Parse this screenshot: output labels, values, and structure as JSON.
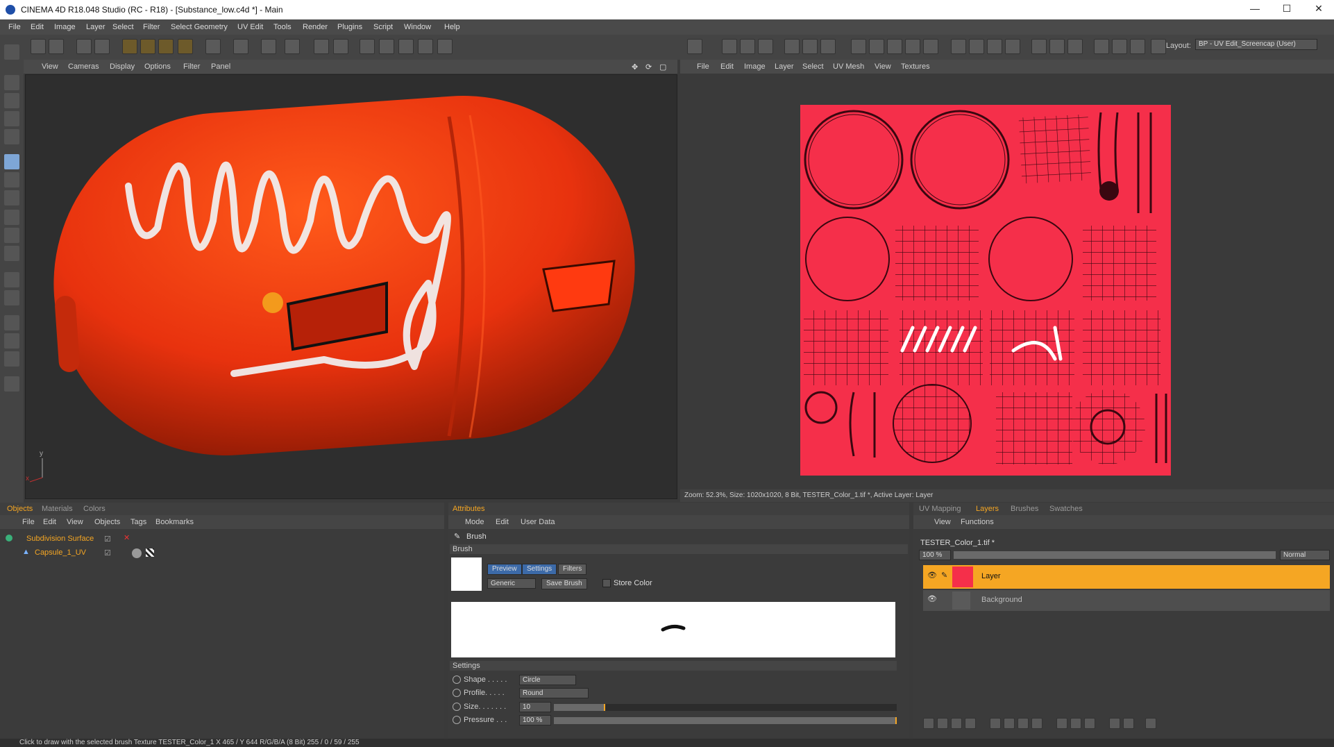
{
  "window": {
    "title": "CINEMA 4D R18.048 Studio (RC - R18) - [Substance_low.c4d *] - Main",
    "controls": [
      "—",
      "☐",
      "✕"
    ]
  },
  "menubar": [
    "File",
    "Edit",
    "Image",
    "Layer",
    "Select",
    "Filter",
    "Select Geometry",
    "UV Edit",
    "Tools",
    "Render",
    "Plugins",
    "Script",
    "Window",
    "Help"
  ],
  "layout": {
    "label": "Layout:",
    "value": "BP - UV Edit_Screencap (User)"
  },
  "viewport": {
    "menu": [
      "View",
      "Cameras",
      "Display",
      "Options",
      "Filter",
      "Panel"
    ],
    "axis_labels": {
      "x": "x",
      "y": "y"
    }
  },
  "uv_editor": {
    "menu": [
      "File",
      "Edit",
      "Image",
      "Layer",
      "Select",
      "UV Mesh",
      "View",
      "Textures"
    ],
    "status": "Zoom: 52.3%, Size: 1020x1020, 8 Bit, TESTER_Color_1.tif *, Active Layer: Layer"
  },
  "objects_panel": {
    "tabs": [
      "Objects",
      "Materials",
      "Colors"
    ],
    "menu": [
      "File",
      "Edit",
      "View",
      "Objects",
      "Tags",
      "Bookmarks"
    ],
    "items": [
      {
        "name": "Subdivision Surface"
      },
      {
        "name": "Capsule_1_UV"
      }
    ]
  },
  "attributes_panel": {
    "tabs": [
      "Attributes"
    ],
    "menu": [
      "Mode",
      "Edit",
      "User Data"
    ],
    "tool_name": "Brush",
    "section": "Brush",
    "subtabs": [
      "Preview",
      "Settings",
      "Filters"
    ],
    "preset": "Generic",
    "save_brush": "Save Brush",
    "store_color": "Store Color",
    "settings_header": "Settings",
    "settings": [
      {
        "label": "Shape . . . . .",
        "value": "Circle"
      },
      {
        "label": "Profile. . . . .",
        "value": "Round"
      },
      {
        "label": "Size. . . . . . .",
        "value": "10",
        "fill_fraction": 0.15
      },
      {
        "label": "Pressure . . .",
        "value": "100 %",
        "fill_fraction": 1.0
      }
    ]
  },
  "layers_panel": {
    "tabs": [
      "UV Mapping",
      "Layers",
      "Brushes",
      "Swatches"
    ],
    "menu": [
      "View",
      "Functions"
    ],
    "file": "TESTER_Color_1.tif *",
    "opacity": "100 %",
    "blend_mode": "Normal",
    "layers": [
      {
        "name": "Layer",
        "active": true
      },
      {
        "name": "Background",
        "active": false
      }
    ]
  },
  "statusbar": "Click to draw with the selected brush  Texture TESTER_Color_1   X 465 / Y 644 R/G/B/A (8 Bit) 255 / 0 / 59 / 255",
  "colors": {
    "accent": "#f5a623",
    "texture": "#f52f4a",
    "object": "#e8320e",
    "brush_cursor": "#f39a1c"
  }
}
